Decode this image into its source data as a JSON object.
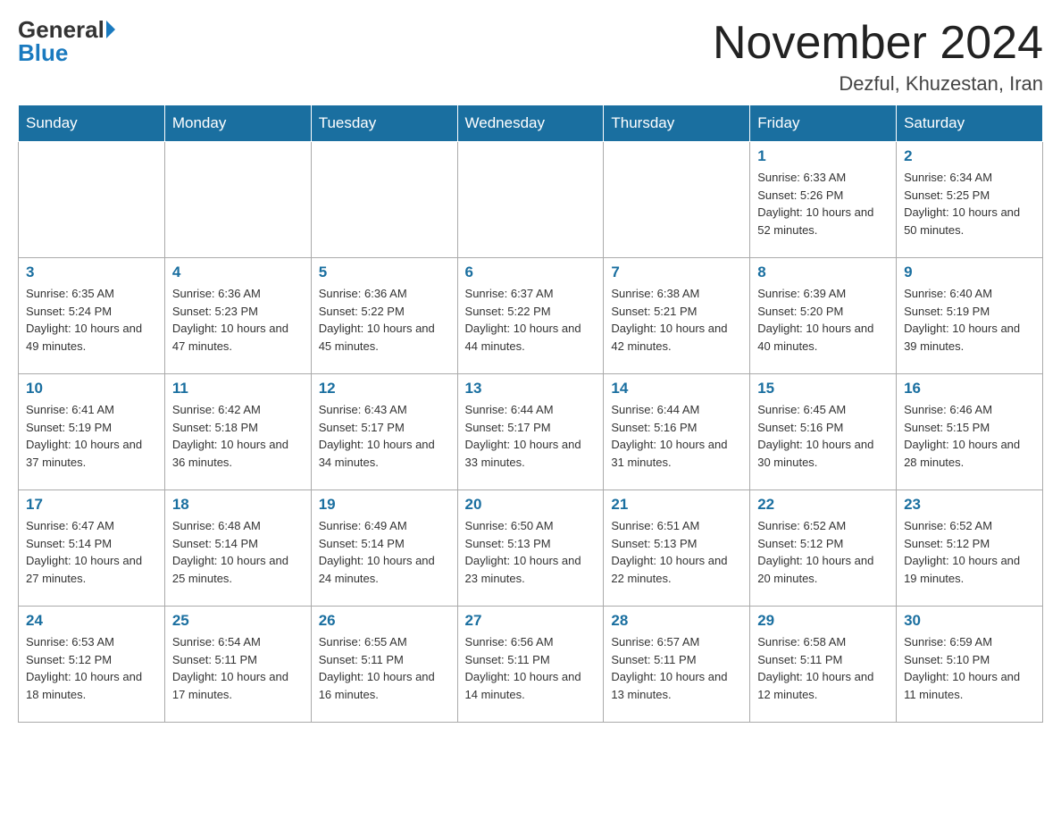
{
  "logo": {
    "general": "General",
    "blue": "Blue"
  },
  "title": "November 2024",
  "subtitle": "Dezful, Khuzestan, Iran",
  "days_of_week": [
    "Sunday",
    "Monday",
    "Tuesday",
    "Wednesday",
    "Thursday",
    "Friday",
    "Saturday"
  ],
  "weeks": [
    [
      {
        "day": "",
        "info": ""
      },
      {
        "day": "",
        "info": ""
      },
      {
        "day": "",
        "info": ""
      },
      {
        "day": "",
        "info": ""
      },
      {
        "day": "",
        "info": ""
      },
      {
        "day": "1",
        "info": "Sunrise: 6:33 AM\nSunset: 5:26 PM\nDaylight: 10 hours and 52 minutes."
      },
      {
        "day": "2",
        "info": "Sunrise: 6:34 AM\nSunset: 5:25 PM\nDaylight: 10 hours and 50 minutes."
      }
    ],
    [
      {
        "day": "3",
        "info": "Sunrise: 6:35 AM\nSunset: 5:24 PM\nDaylight: 10 hours and 49 minutes."
      },
      {
        "day": "4",
        "info": "Sunrise: 6:36 AM\nSunset: 5:23 PM\nDaylight: 10 hours and 47 minutes."
      },
      {
        "day": "5",
        "info": "Sunrise: 6:36 AM\nSunset: 5:22 PM\nDaylight: 10 hours and 45 minutes."
      },
      {
        "day": "6",
        "info": "Sunrise: 6:37 AM\nSunset: 5:22 PM\nDaylight: 10 hours and 44 minutes."
      },
      {
        "day": "7",
        "info": "Sunrise: 6:38 AM\nSunset: 5:21 PM\nDaylight: 10 hours and 42 minutes."
      },
      {
        "day": "8",
        "info": "Sunrise: 6:39 AM\nSunset: 5:20 PM\nDaylight: 10 hours and 40 minutes."
      },
      {
        "day": "9",
        "info": "Sunrise: 6:40 AM\nSunset: 5:19 PM\nDaylight: 10 hours and 39 minutes."
      }
    ],
    [
      {
        "day": "10",
        "info": "Sunrise: 6:41 AM\nSunset: 5:19 PM\nDaylight: 10 hours and 37 minutes."
      },
      {
        "day": "11",
        "info": "Sunrise: 6:42 AM\nSunset: 5:18 PM\nDaylight: 10 hours and 36 minutes."
      },
      {
        "day": "12",
        "info": "Sunrise: 6:43 AM\nSunset: 5:17 PM\nDaylight: 10 hours and 34 minutes."
      },
      {
        "day": "13",
        "info": "Sunrise: 6:44 AM\nSunset: 5:17 PM\nDaylight: 10 hours and 33 minutes."
      },
      {
        "day": "14",
        "info": "Sunrise: 6:44 AM\nSunset: 5:16 PM\nDaylight: 10 hours and 31 minutes."
      },
      {
        "day": "15",
        "info": "Sunrise: 6:45 AM\nSunset: 5:16 PM\nDaylight: 10 hours and 30 minutes."
      },
      {
        "day": "16",
        "info": "Sunrise: 6:46 AM\nSunset: 5:15 PM\nDaylight: 10 hours and 28 minutes."
      }
    ],
    [
      {
        "day": "17",
        "info": "Sunrise: 6:47 AM\nSunset: 5:14 PM\nDaylight: 10 hours and 27 minutes."
      },
      {
        "day": "18",
        "info": "Sunrise: 6:48 AM\nSunset: 5:14 PM\nDaylight: 10 hours and 25 minutes."
      },
      {
        "day": "19",
        "info": "Sunrise: 6:49 AM\nSunset: 5:14 PM\nDaylight: 10 hours and 24 minutes."
      },
      {
        "day": "20",
        "info": "Sunrise: 6:50 AM\nSunset: 5:13 PM\nDaylight: 10 hours and 23 minutes."
      },
      {
        "day": "21",
        "info": "Sunrise: 6:51 AM\nSunset: 5:13 PM\nDaylight: 10 hours and 22 minutes."
      },
      {
        "day": "22",
        "info": "Sunrise: 6:52 AM\nSunset: 5:12 PM\nDaylight: 10 hours and 20 minutes."
      },
      {
        "day": "23",
        "info": "Sunrise: 6:52 AM\nSunset: 5:12 PM\nDaylight: 10 hours and 19 minutes."
      }
    ],
    [
      {
        "day": "24",
        "info": "Sunrise: 6:53 AM\nSunset: 5:12 PM\nDaylight: 10 hours and 18 minutes."
      },
      {
        "day": "25",
        "info": "Sunrise: 6:54 AM\nSunset: 5:11 PM\nDaylight: 10 hours and 17 minutes."
      },
      {
        "day": "26",
        "info": "Sunrise: 6:55 AM\nSunset: 5:11 PM\nDaylight: 10 hours and 16 minutes."
      },
      {
        "day": "27",
        "info": "Sunrise: 6:56 AM\nSunset: 5:11 PM\nDaylight: 10 hours and 14 minutes."
      },
      {
        "day": "28",
        "info": "Sunrise: 6:57 AM\nSunset: 5:11 PM\nDaylight: 10 hours and 13 minutes."
      },
      {
        "day": "29",
        "info": "Sunrise: 6:58 AM\nSunset: 5:11 PM\nDaylight: 10 hours and 12 minutes."
      },
      {
        "day": "30",
        "info": "Sunrise: 6:59 AM\nSunset: 5:10 PM\nDaylight: 10 hours and 11 minutes."
      }
    ]
  ]
}
